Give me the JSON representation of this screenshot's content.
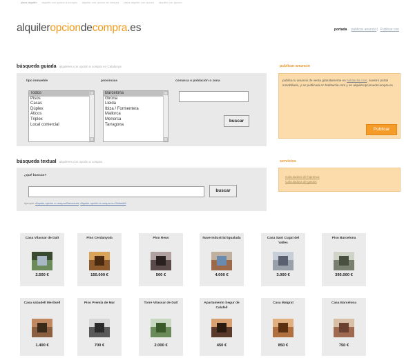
{
  "topbar": [
    "pisos alquiler",
    "alquiler con opcion a compra",
    "alquiler con opcion de compra",
    "pisos alquiler con opcion",
    "alquiler con opcion"
  ],
  "logo": {
    "part1": "alquiler",
    "part2": "opcion",
    "part3": "de",
    "part4": "compra",
    "part5": ".es"
  },
  "langs": {
    "label": "portada",
    "items": [
      "publicar anuncio",
      "Publicar con"
    ]
  },
  "guided_search": {
    "title": "búsqueda guiada",
    "subtitle": "alquileres con opción a compra en Catalunya",
    "col1_label": "tipo inmueble",
    "col2_label": "provincias",
    "col3_label": "comarca o población o zona",
    "types": [
      "Todos",
      "Pisos",
      "Casas",
      "Dúplex",
      "Áticos",
      "Triplex",
      "Local comercial"
    ],
    "provinces": [
      "Barcelona",
      "Girona",
      "Lleida",
      "Ibiza / Formentera",
      "Mallorca",
      "Menorca",
      "Tarragona"
    ],
    "search_label": "buscar"
  },
  "text_search": {
    "title": "búsqueda textual",
    "subtitle": "alquileres con opción a compra",
    "question": "¿qué buscas?",
    "search_label": "buscar",
    "hint": "ejemplo:",
    "hint_link1": "Alquiler opción a compra Barcelona",
    "hint_link2": "Alquiler opción a compra en Sabadell"
  },
  "publicar": {
    "title": "publicar anuncio",
    "text_before": "publica tu anuncio de venta gratuitamente en",
    "link": "habitaclia.com",
    "text_after": ", nuestro portal inmobiliario, y se publicará en habitaclia.com y en alquileropcionedecompra.es",
    "button": "Publicar"
  },
  "servicios": {
    "title": "servicios",
    "links": [
      "Calculadora de hipoteca",
      "Calculadora de gastos"
    ]
  },
  "listings_row1": [
    {
      "title": "Casa Vilassar de Dalt",
      "price": "2.500 €",
      "photo": [
        "#6b8c5a",
        "#3a4a30",
        "#a9b8c6"
      ]
    },
    {
      "title": "Piso Cerdanyola",
      "price": "150.000 €",
      "photo": [
        "#8c5a2a",
        "#d9a45a",
        "#4a2a10"
      ]
    },
    {
      "title": "Piso Reus",
      "price": "500 €",
      "photo": [
        "#5a4a4a",
        "#b0a0a0",
        "#2a2020"
      ]
    },
    {
      "title": "Nave Industrial Igualada",
      "price": "4.000 €",
      "photo": [
        "#9a6a4a",
        "#c0b0a0",
        "#6a8ab0"
      ]
    },
    {
      "title": "Casa Sant Cugat del Vallès",
      "price": "3.000 €",
      "photo": [
        "#9aa0aa",
        "#c8ced8",
        "#5a6070"
      ]
    },
    {
      "title": "Piso Barcelona",
      "price": "395.000 €",
      "photo": [
        "#7a8070",
        "#d0d4c8",
        "#4a5040"
      ]
    }
  ],
  "listings_row2": [
    {
      "title": "Casa sabadell Meritxell",
      "price": "1.400 €",
      "photo": [
        "#8a6040",
        "#c08860",
        "#3a2a1a"
      ]
    },
    {
      "title": "Piso Premià de Mar",
      "price": "700 €",
      "photo": [
        "#5a5a5a",
        "#d8d8d8",
        "#2a2a2a"
      ]
    },
    {
      "title": "Torre Vilassar de Dalt",
      "price": "2.000 €",
      "photo": [
        "#6a8a5a",
        "#c8d8c0",
        "#3a5a2a"
      ]
    },
    {
      "title": "Apartamento Segur de Calafell",
      "price": "450 €",
      "photo": [
        "#5a3a2a",
        "#d8a070",
        "#2a1a10"
      ]
    },
    {
      "title": "Casa Malgrat",
      "price": "850 €",
      "photo": [
        "#b07040",
        "#e0b080",
        "#5a3010"
      ]
    },
    {
      "title": "Casa Barcelona",
      "price": "750 €",
      "photo": [
        "#a06a50",
        "#d8c0a8",
        "#6a4030"
      ]
    }
  ]
}
